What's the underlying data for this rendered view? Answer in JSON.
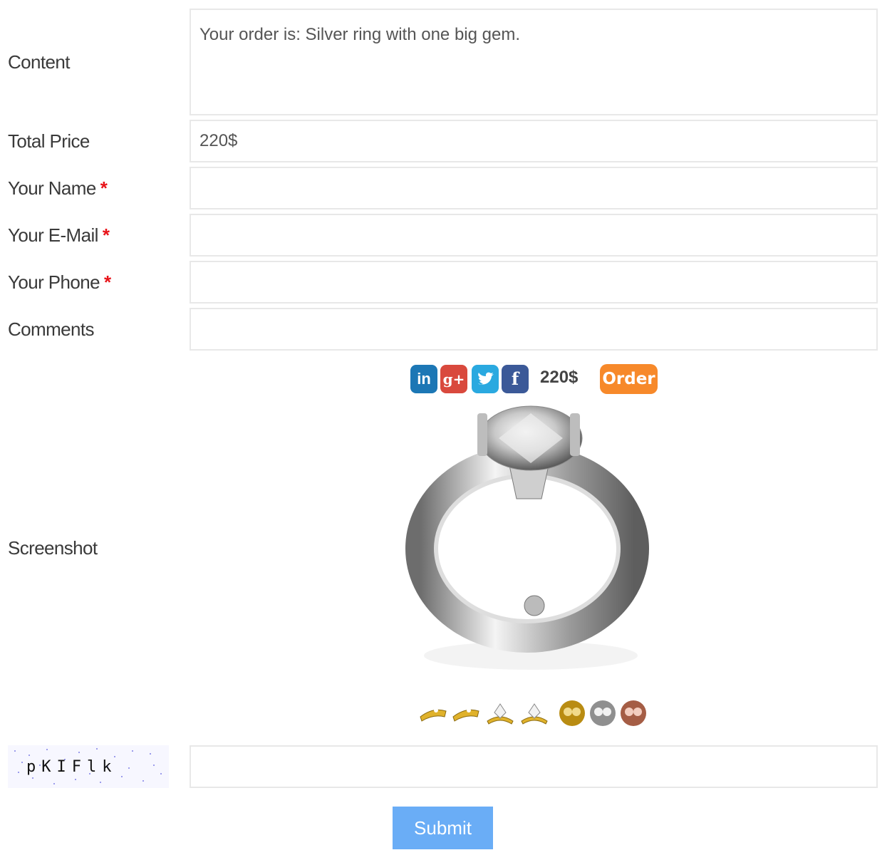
{
  "form": {
    "content": {
      "label": "Content",
      "value": "Your order is: Silver ring with one big gem."
    },
    "total_price": {
      "label": "Total Price",
      "value": "220$"
    },
    "name": {
      "label": "Your Name",
      "required_mark": "*",
      "value": ""
    },
    "email": {
      "label": "Your E-Mail",
      "required_mark": "*",
      "value": ""
    },
    "phone": {
      "label": "Your Phone",
      "required_mark": "*",
      "value": ""
    },
    "comments": {
      "label": "Comments",
      "value": ""
    },
    "screenshot": {
      "label": "Screenshot"
    },
    "captcha": {
      "text": "pKIFlk",
      "value": ""
    },
    "submit_label": "Submit"
  },
  "product": {
    "price": "220$",
    "order_label": "Order",
    "share_icons": [
      "linkedin-icon",
      "google-plus-icon",
      "twitter-icon",
      "facebook-icon"
    ],
    "variant_swatches": [
      "gold-ring-side-1",
      "gold-ring-side-2",
      "gold-ring-gem-1",
      "gold-ring-gem-2",
      "gold-metal",
      "silver-metal",
      "rose-gold-metal"
    ]
  },
  "colors": {
    "required": "#e8141a",
    "order_button": "#f7892a",
    "submit_button": "#6aadf6",
    "linkedin": "#1c77b5",
    "google_plus": "#d9493d",
    "twitter": "#2aa9e0",
    "facebook": "#3b5998"
  }
}
